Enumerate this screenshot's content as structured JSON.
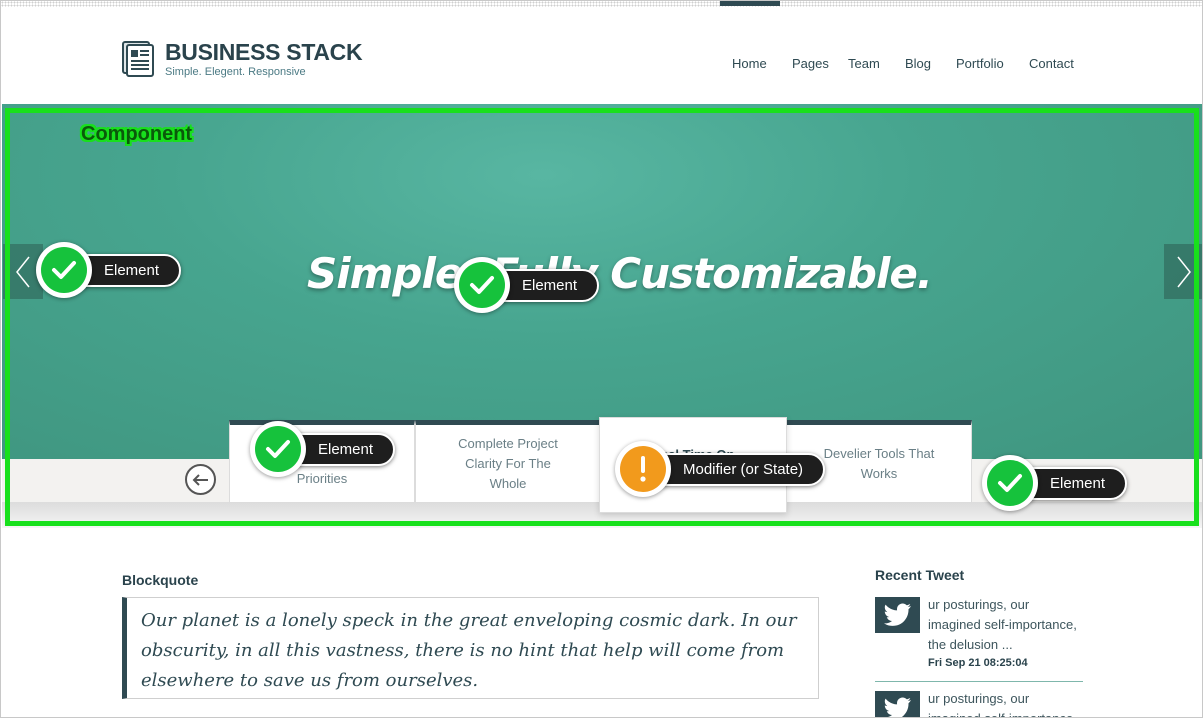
{
  "brand": {
    "name": "BUSINESS STACK",
    "tagline": "Simple. Elegent. Responsive"
  },
  "nav": {
    "items": [
      "Home",
      "Pages",
      "Team",
      "Blog",
      "Portfolio",
      "Contact"
    ]
  },
  "hero": {
    "title": "Simple. Fully Customizable."
  },
  "features": {
    "tabs": [
      {
        "label": "Priorities"
      },
      {
        "label": "Complete Project Clarity For The Whole"
      },
      {
        "label": "Real Time On Business"
      },
      {
        "label": "Develier Tools That Works"
      }
    ]
  },
  "annotations": {
    "component_label": "Component",
    "element_label": "Element",
    "modifier_label": "Modifier (or State)",
    "ok_icon": "check-icon",
    "warn_icon": "exclamation-icon",
    "colors": {
      "component": "#18e01c",
      "ok": "#16c23c",
      "warn": "#f29a1c"
    }
  },
  "content": {
    "blockquote_heading": "Blockquote",
    "blockquote_text": "Our planet is a lonely speck in the great enveloping cosmic dark. In our obscurity, in all this vastness, there is no hint that help will come from elsewhere to save us from ourselves."
  },
  "sidebar": {
    "heading": "Recent Tweet",
    "tweets": [
      {
        "text": "ur posturings, our imagined self-importance, the delusion ...",
        "date": "Fri Sep 21 08:25:04"
      },
      {
        "text": "ur posturings, our imagined self-importance,"
      }
    ]
  },
  "theme": {
    "primary": "#2f4a52",
    "hero": "#4aa890"
  }
}
